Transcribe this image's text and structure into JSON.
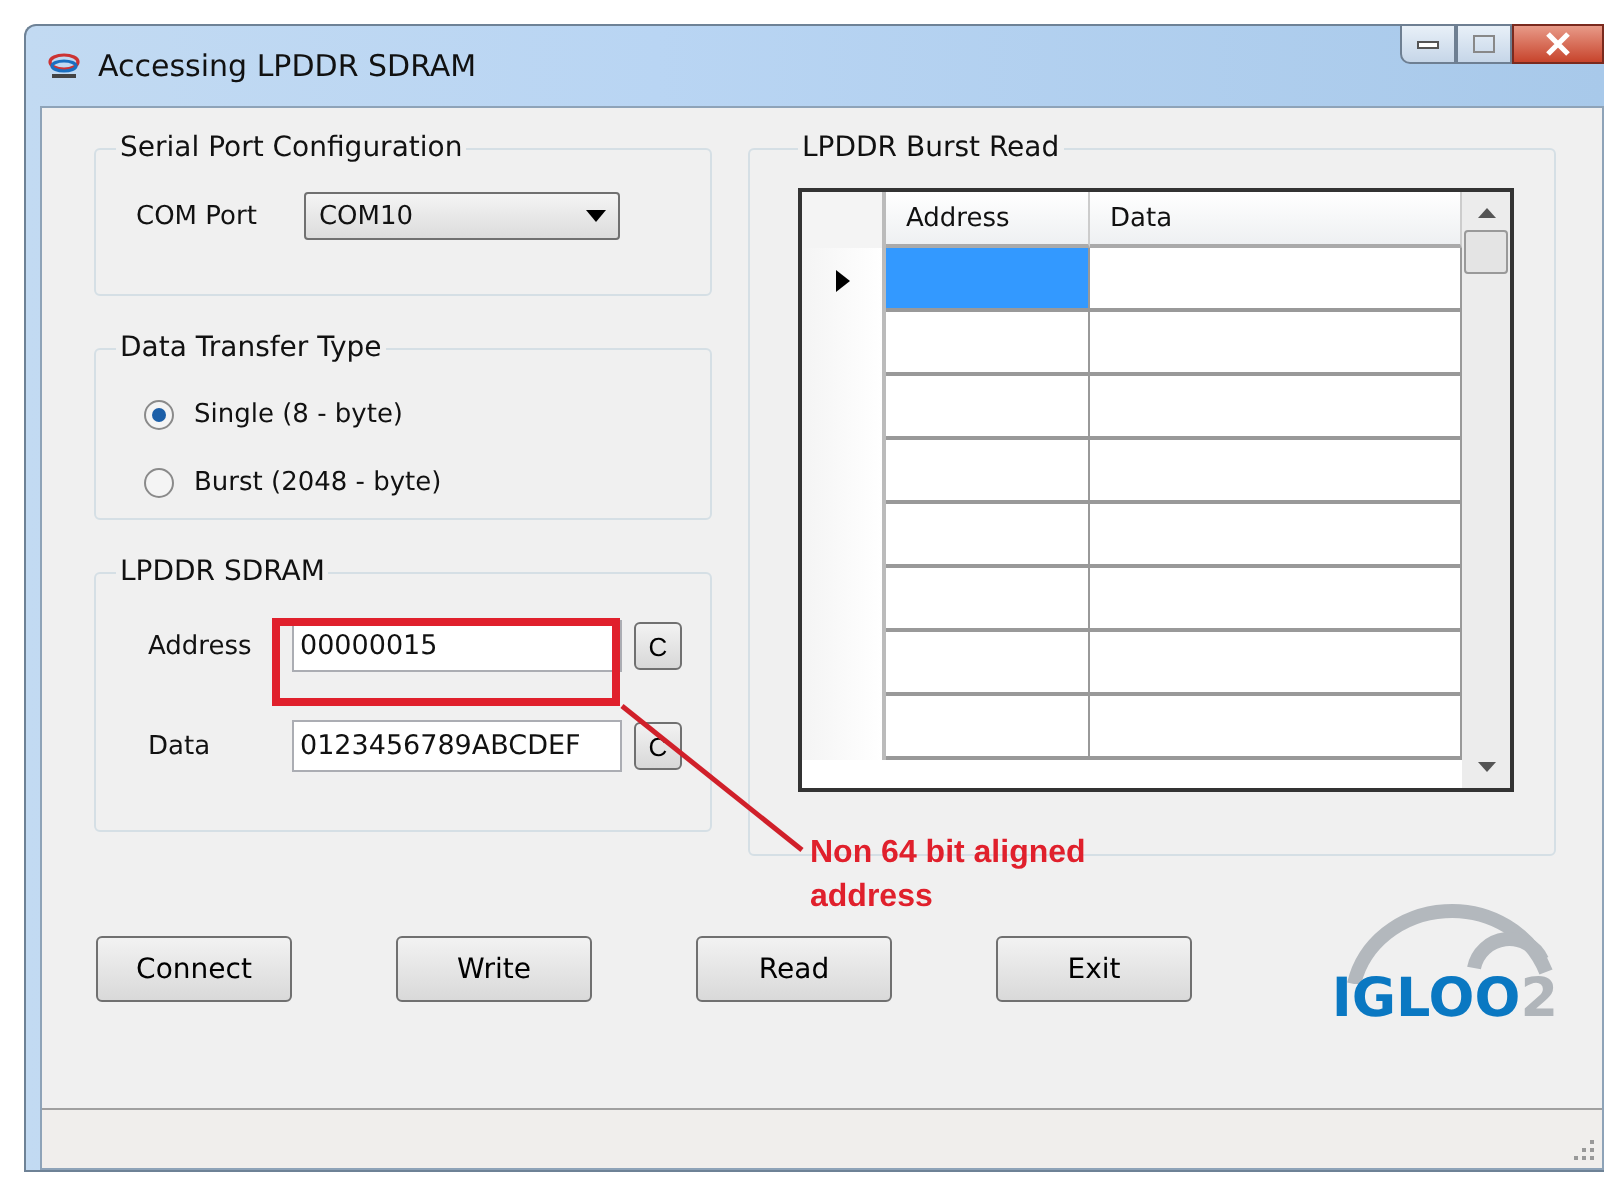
{
  "window": {
    "title": "Accessing LPDDR SDRAM"
  },
  "serial_port": {
    "title": "Serial Port Configuration",
    "label": "COM Port",
    "value": "COM10"
  },
  "transfer_type": {
    "title": "Data Transfer Type",
    "options": [
      {
        "label": "Single (8 - byte)",
        "selected": true
      },
      {
        "label": "Burst (2048 - byte)",
        "selected": false
      }
    ]
  },
  "sdram": {
    "title": "LPDDR SDRAM",
    "fields": [
      {
        "label": "Address",
        "value": "00000015",
        "button": "C"
      },
      {
        "label": "Data",
        "value": "0123456789ABCDEF",
        "button": "C"
      }
    ]
  },
  "burst_read": {
    "title": "LPDDR Burst Read",
    "columns": [
      "Address",
      "Data"
    ],
    "rows": [
      {
        "selected": true
      },
      {
        "selected": false
      },
      {
        "selected": false
      },
      {
        "selected": false
      },
      {
        "selected": false
      },
      {
        "selected": false
      },
      {
        "selected": false
      },
      {
        "selected": false
      }
    ]
  },
  "buttons": [
    "Connect",
    "Write",
    "Read",
    "Exit"
  ],
  "annotation": {
    "lines": [
      "Non 64 bit aligned",
      "address"
    ]
  },
  "logo": {
    "text": "IGLOO",
    "suffix": "2"
  }
}
